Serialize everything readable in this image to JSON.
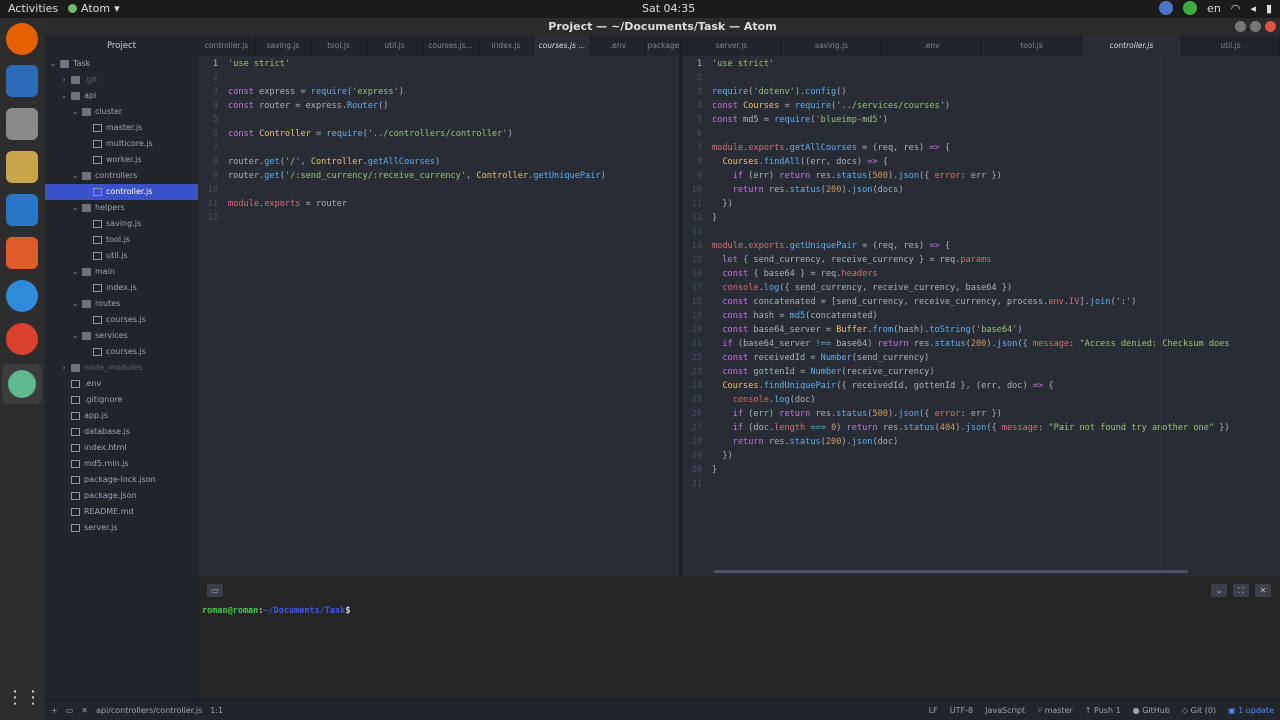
{
  "os": {
    "activities": "Activities",
    "app_name": "Atom",
    "clock": "Sat 04:35",
    "lang": "en"
  },
  "window": {
    "title": "Project — ~/Documents/Task — Atom"
  },
  "sidebar": {
    "header": "Project",
    "items": [
      {
        "label": "Task",
        "depth": 0,
        "type": "root",
        "open": true
      },
      {
        "label": ".git",
        "depth": 1,
        "type": "folder",
        "open": false,
        "dim": true
      },
      {
        "label": "api",
        "depth": 1,
        "type": "folder",
        "open": true
      },
      {
        "label": "cluster",
        "depth": 2,
        "type": "folder",
        "open": true
      },
      {
        "label": "master.js",
        "depth": 3,
        "type": "file"
      },
      {
        "label": "multicore.js",
        "depth": 3,
        "type": "file"
      },
      {
        "label": "worker.js",
        "depth": 3,
        "type": "file"
      },
      {
        "label": "controllers",
        "depth": 2,
        "type": "folder",
        "open": true
      },
      {
        "label": "controller.js",
        "depth": 3,
        "type": "file",
        "selected": true
      },
      {
        "label": "helpers",
        "depth": 2,
        "type": "folder",
        "open": true
      },
      {
        "label": "saving.js",
        "depth": 3,
        "type": "file"
      },
      {
        "label": "tool.js",
        "depth": 3,
        "type": "file"
      },
      {
        "label": "util.js",
        "depth": 3,
        "type": "file"
      },
      {
        "label": "main",
        "depth": 2,
        "type": "folder",
        "open": true
      },
      {
        "label": "index.js",
        "depth": 3,
        "type": "file"
      },
      {
        "label": "routes",
        "depth": 2,
        "type": "folder",
        "open": true
      },
      {
        "label": "courses.js",
        "depth": 3,
        "type": "file"
      },
      {
        "label": "services",
        "depth": 2,
        "type": "folder",
        "open": true
      },
      {
        "label": "courses.js",
        "depth": 3,
        "type": "file"
      },
      {
        "label": "node_modules",
        "depth": 1,
        "type": "folder",
        "open": false,
        "dim": true
      },
      {
        "label": ".env",
        "depth": 1,
        "type": "file"
      },
      {
        "label": ".gitignore",
        "depth": 1,
        "type": "file"
      },
      {
        "label": "app.js",
        "depth": 1,
        "type": "file"
      },
      {
        "label": "database.js",
        "depth": 1,
        "type": "file"
      },
      {
        "label": "index.html",
        "depth": 1,
        "type": "file"
      },
      {
        "label": "md5.min.js",
        "depth": 1,
        "type": "file"
      },
      {
        "label": "package-lock.json",
        "depth": 1,
        "type": "file"
      },
      {
        "label": "package.json",
        "depth": 1,
        "type": "file"
      },
      {
        "label": "README.md",
        "depth": 1,
        "type": "file"
      },
      {
        "label": "server.js",
        "depth": 1,
        "type": "file"
      }
    ]
  },
  "left_tabs": [
    {
      "label": "controller.js"
    },
    {
      "label": "saving.js"
    },
    {
      "label": "tool.js"
    },
    {
      "label": "util.js"
    },
    {
      "label": "courses.js..."
    },
    {
      "label": "index.js"
    },
    {
      "label": "courses.js ...",
      "active": true
    },
    {
      "label": ".env"
    },
    {
      "label": "package"
    }
  ],
  "right_tabs": [
    {
      "label": "server.js"
    },
    {
      "label": "saving.js"
    },
    {
      "label": ".env"
    },
    {
      "label": "tool.js"
    },
    {
      "label": "controller.js",
      "active": true
    },
    {
      "label": "util.js"
    }
  ],
  "left_code": [
    [
      [
        "str",
        "'use strict'"
      ]
    ],
    [],
    [
      [
        "kw",
        "const"
      ],
      [
        "pl",
        " express = "
      ],
      [
        "fn",
        "require"
      ],
      [
        "pl",
        "("
      ],
      [
        "str",
        "'express'"
      ],
      [
        "pl",
        ")"
      ]
    ],
    [
      [
        "kw",
        "const"
      ],
      [
        "pl",
        " router = express."
      ],
      [
        "fn",
        "Router"
      ],
      [
        "pl",
        "()"
      ]
    ],
    [],
    [
      [
        "kw",
        "const"
      ],
      [
        "pl",
        " "
      ],
      [
        "cls",
        "Controller"
      ],
      [
        "pl",
        " = "
      ],
      [
        "fn",
        "require"
      ],
      [
        "pl",
        "("
      ],
      [
        "str",
        "'../controllers/controller'"
      ],
      [
        "pl",
        ")"
      ]
    ],
    [],
    [
      [
        "pl",
        "router."
      ],
      [
        "fn",
        "get"
      ],
      [
        "pl",
        "("
      ],
      [
        "str",
        "'/'"
      ],
      [
        "pl",
        ", "
      ],
      [
        "cls",
        "Controller"
      ],
      [
        "pl",
        "."
      ],
      [
        "fn",
        "getAllCourses"
      ],
      [
        "pl",
        ")"
      ]
    ],
    [
      [
        "pl",
        "router."
      ],
      [
        "fn",
        "get"
      ],
      [
        "pl",
        "("
      ],
      [
        "str",
        "'/:send_currency/:receive_currency'"
      ],
      [
        "pl",
        ", "
      ],
      [
        "cls",
        "Controller"
      ],
      [
        "pl",
        "."
      ],
      [
        "fn",
        "getUniquePair"
      ],
      [
        "pl",
        ")"
      ]
    ],
    [],
    [
      [
        "prop",
        "module"
      ],
      [
        "pl",
        "."
      ],
      [
        "prop",
        "exports"
      ],
      [
        "pl",
        " = router"
      ]
    ],
    []
  ],
  "right_code": [
    [
      [
        "str",
        "'use strict'"
      ]
    ],
    [],
    [
      [
        "fn",
        "require"
      ],
      [
        "pl",
        "("
      ],
      [
        "str",
        "'dotenv'"
      ],
      [
        "pl",
        ")."
      ],
      [
        "fn",
        "config"
      ],
      [
        "pl",
        "()"
      ]
    ],
    [
      [
        "kw",
        "const"
      ],
      [
        "pl",
        " "
      ],
      [
        "cls",
        "Courses"
      ],
      [
        "pl",
        " = "
      ],
      [
        "fn",
        "require"
      ],
      [
        "pl",
        "("
      ],
      [
        "str",
        "'../services/courses'"
      ],
      [
        "pl",
        ")"
      ]
    ],
    [
      [
        "kw",
        "const"
      ],
      [
        "pl",
        " md5 = "
      ],
      [
        "fn",
        "require"
      ],
      [
        "pl",
        "("
      ],
      [
        "str",
        "'blueimp-md5'"
      ],
      [
        "pl",
        ")"
      ]
    ],
    [],
    [
      [
        "prop",
        "module"
      ],
      [
        "pl",
        "."
      ],
      [
        "prop",
        "exports"
      ],
      [
        "pl",
        "."
      ],
      [
        "fn",
        "getAllCourses"
      ],
      [
        "pl",
        " = (req, res) "
      ],
      [
        "kw",
        "=>"
      ],
      [
        "pl",
        " {"
      ]
    ],
    [
      [
        "pl",
        "  "
      ],
      [
        "cls",
        "Courses"
      ],
      [
        "pl",
        "."
      ],
      [
        "fn",
        "findAll"
      ],
      [
        "pl",
        "((err, docs) "
      ],
      [
        "kw",
        "=>"
      ],
      [
        "pl",
        " {"
      ]
    ],
    [
      [
        "pl",
        "    "
      ],
      [
        "kw",
        "if"
      ],
      [
        "pl",
        " (err) "
      ],
      [
        "kw",
        "return"
      ],
      [
        "pl",
        " res."
      ],
      [
        "fn",
        "status"
      ],
      [
        "pl",
        "("
      ],
      [
        "num2",
        "500"
      ],
      [
        "pl",
        ")."
      ],
      [
        "fn",
        "json"
      ],
      [
        "pl",
        "({ "
      ],
      [
        "prop",
        "error"
      ],
      [
        "pl",
        ": err })"
      ]
    ],
    [
      [
        "pl",
        "    "
      ],
      [
        "kw",
        "return"
      ],
      [
        "pl",
        " res."
      ],
      [
        "fn",
        "status"
      ],
      [
        "pl",
        "("
      ],
      [
        "num2",
        "200"
      ],
      [
        "pl",
        ")."
      ],
      [
        "fn",
        "json"
      ],
      [
        "pl",
        "(docs)"
      ]
    ],
    [
      [
        "pl",
        "  })"
      ]
    ],
    [
      [
        "pl",
        "}"
      ]
    ],
    [],
    [
      [
        "prop",
        "module"
      ],
      [
        "pl",
        "."
      ],
      [
        "prop",
        "exports"
      ],
      [
        "pl",
        "."
      ],
      [
        "fn",
        "getUniquePair"
      ],
      [
        "pl",
        " = (req, res) "
      ],
      [
        "kw",
        "=>"
      ],
      [
        "pl",
        " {"
      ]
    ],
    [
      [
        "pl",
        "  "
      ],
      [
        "kw",
        "let"
      ],
      [
        "pl",
        " { send_currency, receive_currency } = req."
      ],
      [
        "prop",
        "params"
      ]
    ],
    [
      [
        "pl",
        "  "
      ],
      [
        "kw",
        "const"
      ],
      [
        "pl",
        " { base64 } = req."
      ],
      [
        "prop",
        "headers"
      ]
    ],
    [
      [
        "pl",
        "  "
      ],
      [
        "prop",
        "console"
      ],
      [
        "pl",
        "."
      ],
      [
        "fn",
        "log"
      ],
      [
        "pl",
        "({ send_currency, receive_currency, base64 })"
      ]
    ],
    [
      [
        "pl",
        "  "
      ],
      [
        "kw",
        "const"
      ],
      [
        "pl",
        " concatenated = [send_currency, receive_currency, process."
      ],
      [
        "prop",
        "env"
      ],
      [
        "pl",
        "."
      ],
      [
        "prop",
        "IV"
      ],
      [
        "pl",
        "]."
      ],
      [
        "fn",
        "join"
      ],
      [
        "pl",
        "("
      ],
      [
        "str",
        "':'"
      ],
      [
        "pl",
        ")"
      ]
    ],
    [
      [
        "pl",
        "  "
      ],
      [
        "kw",
        "const"
      ],
      [
        "pl",
        " hash = "
      ],
      [
        "fn",
        "md5"
      ],
      [
        "pl",
        "(concatenated)"
      ]
    ],
    [
      [
        "pl",
        "  "
      ],
      [
        "kw",
        "const"
      ],
      [
        "pl",
        " base64_server = "
      ],
      [
        "cls",
        "Buffer"
      ],
      [
        "pl",
        "."
      ],
      [
        "fn",
        "from"
      ],
      [
        "pl",
        "(hash)."
      ],
      [
        "fn",
        "toString"
      ],
      [
        "pl",
        "("
      ],
      [
        "str",
        "'base64'"
      ],
      [
        "pl",
        ")"
      ]
    ],
    [
      [
        "pl",
        "  "
      ],
      [
        "kw",
        "if"
      ],
      [
        "pl",
        " (base64_server "
      ],
      [
        "op",
        "!=="
      ],
      [
        "pl",
        " base64) "
      ],
      [
        "kw",
        "return"
      ],
      [
        "pl",
        " res."
      ],
      [
        "fn",
        "status"
      ],
      [
        "pl",
        "("
      ],
      [
        "num2",
        "200"
      ],
      [
        "pl",
        ")."
      ],
      [
        "fn",
        "json"
      ],
      [
        "pl",
        "({ "
      ],
      [
        "prop",
        "message"
      ],
      [
        "pl",
        ": "
      ],
      [
        "str",
        "\"Access denied: Checksum does"
      ]
    ],
    [
      [
        "pl",
        "  "
      ],
      [
        "kw",
        "const"
      ],
      [
        "pl",
        " receivedId = "
      ],
      [
        "fn",
        "Number"
      ],
      [
        "pl",
        "(send_currency)"
      ]
    ],
    [
      [
        "pl",
        "  "
      ],
      [
        "kw",
        "const"
      ],
      [
        "pl",
        " gottenId = "
      ],
      [
        "fn",
        "Number"
      ],
      [
        "pl",
        "(receive_currency)"
      ]
    ],
    [
      [
        "pl",
        "  "
      ],
      [
        "cls",
        "Courses"
      ],
      [
        "pl",
        "."
      ],
      [
        "fn",
        "findUniquePair"
      ],
      [
        "pl",
        "({ receivedId, gottenId }, (err, doc) "
      ],
      [
        "kw",
        "=>"
      ],
      [
        "pl",
        " {"
      ]
    ],
    [
      [
        "pl",
        "    "
      ],
      [
        "prop",
        "console"
      ],
      [
        "pl",
        "."
      ],
      [
        "fn",
        "log"
      ],
      [
        "pl",
        "(doc)"
      ]
    ],
    [
      [
        "pl",
        "    "
      ],
      [
        "kw",
        "if"
      ],
      [
        "pl",
        " (err) "
      ],
      [
        "kw",
        "return"
      ],
      [
        "pl",
        " res."
      ],
      [
        "fn",
        "status"
      ],
      [
        "pl",
        "("
      ],
      [
        "num2",
        "500"
      ],
      [
        "pl",
        ")."
      ],
      [
        "fn",
        "json"
      ],
      [
        "pl",
        "({ "
      ],
      [
        "prop",
        "error"
      ],
      [
        "pl",
        ": err })"
      ]
    ],
    [
      [
        "pl",
        "    "
      ],
      [
        "kw",
        "if"
      ],
      [
        "pl",
        " (doc."
      ],
      [
        "prop",
        "length"
      ],
      [
        "pl",
        " "
      ],
      [
        "op",
        "==="
      ],
      [
        "pl",
        " "
      ],
      [
        "num2",
        "0"
      ],
      [
        "pl",
        ") "
      ],
      [
        "kw",
        "return"
      ],
      [
        "pl",
        " res."
      ],
      [
        "fn",
        "status"
      ],
      [
        "pl",
        "("
      ],
      [
        "num2",
        "404"
      ],
      [
        "pl",
        ")."
      ],
      [
        "fn",
        "json"
      ],
      [
        "pl",
        "({ "
      ],
      [
        "prop",
        "message"
      ],
      [
        "pl",
        ": "
      ],
      [
        "str",
        "\"Pair not found try another one\""
      ],
      [
        "pl",
        " })"
      ]
    ],
    [
      [
        "pl",
        "    "
      ],
      [
        "kw",
        "return"
      ],
      [
        "pl",
        " res."
      ],
      [
        "fn",
        "status"
      ],
      [
        "pl",
        "("
      ],
      [
        "num2",
        "200"
      ],
      [
        "pl",
        ")."
      ],
      [
        "fn",
        "json"
      ],
      [
        "pl",
        "(doc)"
      ]
    ],
    [
      [
        "pl",
        "  })"
      ]
    ],
    [
      [
        "pl",
        "}"
      ]
    ],
    []
  ],
  "terminal": {
    "user": "roman@roman",
    "sep": ":",
    "path": "~/Documents/Task",
    "suffix": "$"
  },
  "status": {
    "path": "api/controllers/controller.js",
    "cursor": "1:1",
    "eol": "LF",
    "encoding": "UTF-8",
    "grammar": "JavaScript",
    "branch": "master",
    "push": "Push 1",
    "github": "GitHub",
    "git": "Git (0)",
    "update": "1 update"
  }
}
